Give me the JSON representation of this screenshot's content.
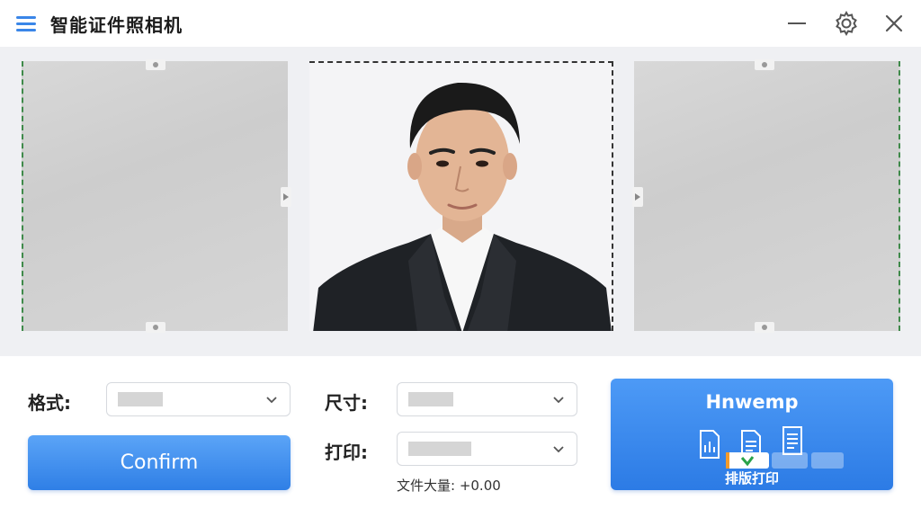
{
  "app": {
    "title": "智能证件照相机"
  },
  "window": {
    "minimize": "minimize",
    "settings": "settings",
    "close": "close"
  },
  "form": {
    "format_label": "格式:",
    "format_value": "",
    "size_label": "尺寸:",
    "size_value": "",
    "print_label": "打印:",
    "print_value": "",
    "file_size": "文件大量: +0.00"
  },
  "buttons": {
    "confirm": "Confirm"
  },
  "print_card": {
    "title": "Hnwemp",
    "label": "排版打印"
  },
  "icons": {
    "menu": "hamburger-menu-icon",
    "minimize": "minus-icon",
    "settings": "gear-icon",
    "close": "close-icon",
    "chevron": "chevron-down-icon",
    "document": "document-icon"
  },
  "colors": {
    "accent": "#2f7fe6",
    "accent_light": "#5ba4f7",
    "frame_dash": "#3f8a4a"
  }
}
